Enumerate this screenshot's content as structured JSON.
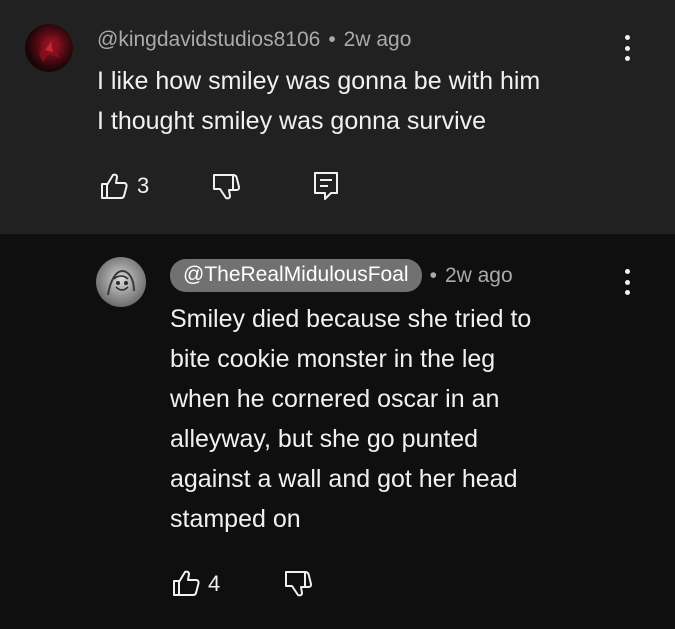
{
  "comment": {
    "handle": "@kingdavidstudios8106",
    "separator": "•",
    "time": "2w ago",
    "lines": [
      "I like how smiley was gonna be with him",
      "I thought smiley was gonna survive"
    ],
    "like_count": "3",
    "icons": {
      "like": "thumbs-up-icon",
      "dislike": "thumbs-down-icon",
      "reply": "reply-icon",
      "more": "more-vert-icon"
    }
  },
  "reply": {
    "handle": "@TheRealMidulousFoal",
    "separator": "•",
    "time": "2w ago",
    "lines": [
      "Smiley died because she tried to",
      "bite cookie monster in the leg",
      "when he cornered oscar in an",
      "alleyway, but she go punted",
      "against a wall and got her head",
      "stamped on"
    ],
    "like_count": "4",
    "icons": {
      "like": "thumbs-up-icon",
      "dislike": "thumbs-down-icon",
      "more": "more-vert-icon"
    }
  },
  "colors": {
    "top_background": "#212121",
    "reply_background": "#0f0f0f",
    "handle_pill": "#717171",
    "meta_text": "#aaaaaa"
  }
}
